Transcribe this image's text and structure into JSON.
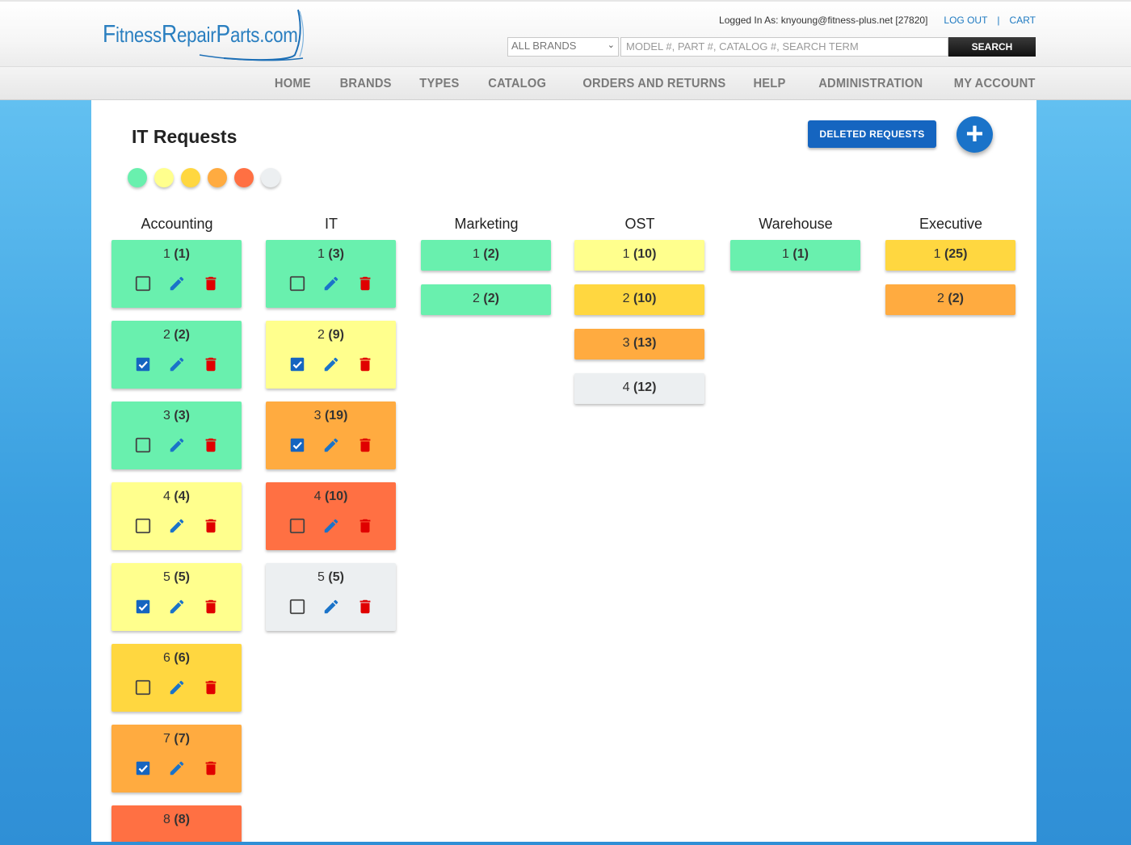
{
  "header": {
    "logo_text": "FitnessRepairParts.com",
    "logged_in": "Logged In As: knyoung@fitness-plus.net [27820]",
    "logout": "LOG OUT",
    "cart": "CART",
    "brand_select": "ALL BRANDS",
    "search_placeholder": "MODEL #, PART #, CATALOG #, SEARCH TERM",
    "search_button": "SEARCH"
  },
  "nav": [
    "HOME",
    "BRANDS",
    "TYPES",
    "CATALOG",
    "ORDERS AND RETURNS",
    "HELP",
    "ADMINISTRATION",
    "MY ACCOUNT"
  ],
  "page": {
    "title": "IT Requests",
    "deleted_button": "DELETED REQUESTS",
    "add_button": "+"
  },
  "colors": {
    "green": "#69f0ae",
    "light_yellow": "#ffff8d",
    "yellow": "#ffd740",
    "orange": "#ffab40",
    "deep_orange": "#ff7043",
    "grey": "#eceff1"
  },
  "legend": [
    "green",
    "light_yellow",
    "yellow",
    "orange",
    "deep_orange",
    "grey"
  ],
  "columns": [
    {
      "title": "Accounting",
      "cards": [
        {
          "num": "1",
          "count": "(1)",
          "color": "green",
          "checked": false
        },
        {
          "num": "2",
          "count": "(2)",
          "color": "green",
          "checked": true
        },
        {
          "num": "3",
          "count": "(3)",
          "color": "green",
          "checked": false
        },
        {
          "num": "4",
          "count": "(4)",
          "color": "light_yellow",
          "checked": false
        },
        {
          "num": "5",
          "count": "(5)",
          "color": "light_yellow",
          "checked": true
        },
        {
          "num": "6",
          "count": "(6)",
          "color": "yellow",
          "checked": false
        },
        {
          "num": "7",
          "count": "(7)",
          "color": "orange",
          "checked": true
        },
        {
          "num": "8",
          "count": "(8)",
          "color": "deep_orange",
          "checked": false
        }
      ]
    },
    {
      "title": "IT",
      "cards": [
        {
          "num": "1",
          "count": "(3)",
          "color": "green",
          "checked": false
        },
        {
          "num": "2",
          "count": "(9)",
          "color": "light_yellow",
          "checked": true
        },
        {
          "num": "3",
          "count": "(19)",
          "color": "orange",
          "checked": true
        },
        {
          "num": "4",
          "count": "(10)",
          "color": "deep_orange",
          "checked": false
        },
        {
          "num": "5",
          "count": "(5)",
          "color": "grey",
          "checked": false
        }
      ]
    },
    {
      "title": "Marketing",
      "cards": [
        {
          "num": "1",
          "count": "(2)",
          "color": "green"
        },
        {
          "num": "2",
          "count": "(2)",
          "color": "green"
        }
      ]
    },
    {
      "title": "OST",
      "cards": [
        {
          "num": "1",
          "count": "(10)",
          "color": "light_yellow"
        },
        {
          "num": "2",
          "count": "(10)",
          "color": "yellow"
        },
        {
          "num": "3",
          "count": "(13)",
          "color": "orange"
        },
        {
          "num": "4",
          "count": "(12)",
          "color": "grey"
        }
      ]
    },
    {
      "title": "Warehouse",
      "cards": [
        {
          "num": "1",
          "count": "(1)",
          "color": "green"
        }
      ]
    },
    {
      "title": "Executive",
      "cards": [
        {
          "num": "1",
          "count": "(25)",
          "color": "yellow"
        },
        {
          "num": "2",
          "count": "(2)",
          "color": "orange"
        }
      ]
    }
  ]
}
